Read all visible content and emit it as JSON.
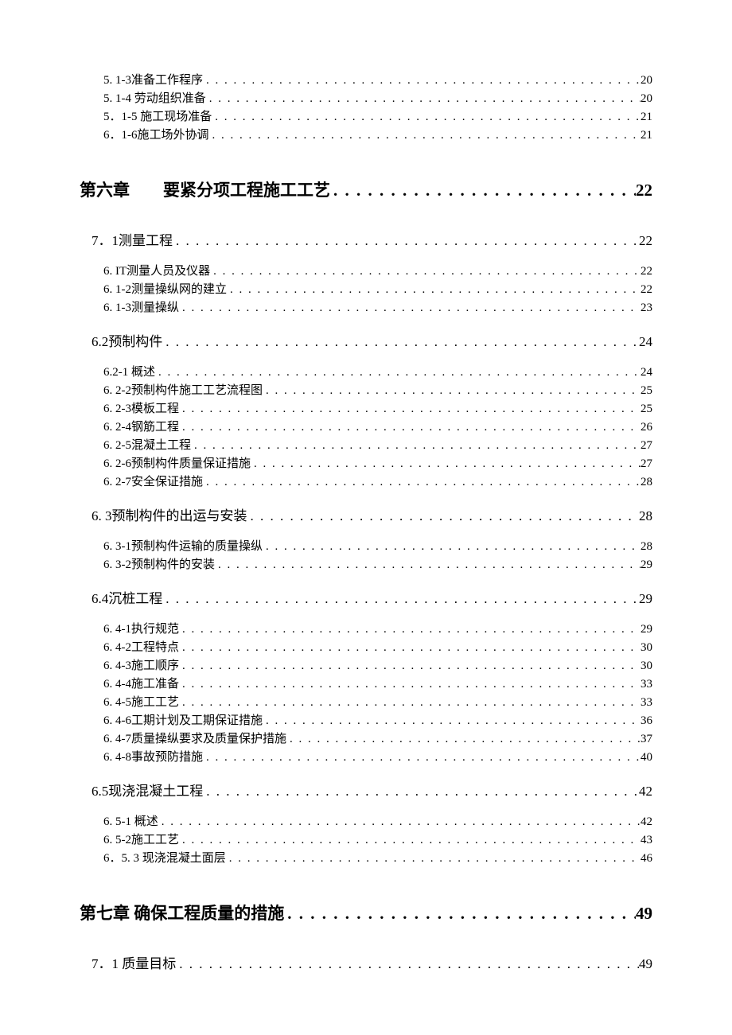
{
  "toc": [
    {
      "level": "sub",
      "label": "5. 1-3准备工作程序",
      "page": "20"
    },
    {
      "level": "sub",
      "label": "5. 1-4 劳动组织准备",
      "page": "20"
    },
    {
      "level": "sub",
      "label": "5．1-5 施工现场准备",
      "page": "21"
    },
    {
      "level": "sub",
      "label": "6．1-6施工场外协调",
      "page": "21"
    },
    {
      "level": "ch",
      "label": "第六章　　要紧分项工程施工工艺",
      "page": "22"
    },
    {
      "level": "sec",
      "label": "7．1测量工程",
      "page": "22"
    },
    {
      "level": "sub",
      "label": "6. IT测量人员及仪器",
      "page": "22"
    },
    {
      "level": "sub",
      "label": "6. 1-2测量操纵网的建立",
      "page": "22"
    },
    {
      "level": "sub",
      "label": "6. 1-3测量操纵",
      "page": "23"
    },
    {
      "level": "sec",
      "label": "6.2预制构件",
      "page": "24"
    },
    {
      "level": "sub",
      "label": "6.2-1 概述",
      "page": "24"
    },
    {
      "level": "sub",
      "label": "6. 2-2预制构件施工工艺流程图",
      "page": "25"
    },
    {
      "level": "sub",
      "label": "6. 2-3模板工程",
      "page": "25"
    },
    {
      "level": "sub",
      "label": "6. 2-4钢筋工程",
      "page": "26"
    },
    {
      "level": "sub",
      "label": "6. 2-5混凝土工程",
      "page": "27"
    },
    {
      "level": "sub",
      "label": "6. 2-6预制构件质量保证措施",
      "page": "27"
    },
    {
      "level": "sub",
      "label": "6. 2-7安全保证措施",
      "page": "28"
    },
    {
      "level": "sec",
      "label": "6. 3预制构件的出运与安装",
      "page": "28"
    },
    {
      "level": "sub",
      "label": "6. 3-1预制构件运输的质量操纵",
      "page": "28"
    },
    {
      "level": "sub",
      "label": "6. 3-2预制构件的安装",
      "page": "29"
    },
    {
      "level": "sec",
      "label": "6.4沉桩工程",
      "page": "29"
    },
    {
      "level": "sub",
      "label": "6. 4-1执行规范",
      "page": "29"
    },
    {
      "level": "sub",
      "label": "6. 4-2工程特点",
      "page": "30"
    },
    {
      "level": "sub",
      "label": "6. 4-3施工顺序",
      "page": "30"
    },
    {
      "level": "sub",
      "label": "6. 4-4施工准备",
      "page": "33"
    },
    {
      "level": "sub",
      "label": "6. 4-5施工工艺",
      "page": "33"
    },
    {
      "level": "sub",
      "label": "6. 4-6工期计划及工期保证措施",
      "page": "36"
    },
    {
      "level": "sub",
      "label": "6. 4-7质量操纵要求及质量保护措施",
      "page": "37"
    },
    {
      "level": "sub",
      "label": "6. 4-8事故预防措施",
      "page": "40"
    },
    {
      "level": "sec",
      "label": "6.5现浇混凝土工程",
      "page": "42"
    },
    {
      "level": "sub",
      "label": "6. 5-1 概述",
      "page": "42"
    },
    {
      "level": "sub",
      "label": "6. 5-2施工工艺",
      "page": "43"
    },
    {
      "level": "sub",
      "label": "6．5. 3 现浇混凝土面层",
      "page": "46"
    },
    {
      "level": "ch",
      "label": "第七章  确保工程质量的措施",
      "page": "49"
    },
    {
      "level": "sec",
      "label": "7．1 质量目标",
      "page": "49"
    }
  ]
}
